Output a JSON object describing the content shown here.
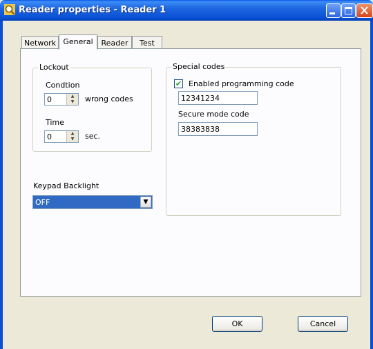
{
  "window": {
    "title": "Reader properties - Reader 1"
  },
  "tabs": [
    {
      "label": "Network"
    },
    {
      "label": "General",
      "active": true
    },
    {
      "label": "Reader"
    },
    {
      "label": "Test"
    }
  ],
  "lockout": {
    "legend": "Lockout",
    "condition_label": "Condtion",
    "condition_value": "0",
    "condition_unit": "wrong codes",
    "time_label": "Time",
    "time_value": "0",
    "time_unit": "sec."
  },
  "special_codes": {
    "legend": "Special codes",
    "enabled_checked": true,
    "enabled_label": "Enabled programming code",
    "programming_code": "12341234",
    "secure_label": "Secure mode code",
    "secure_code": "38383838"
  },
  "backlight": {
    "label": "Keypad Backlight",
    "selected": "OFF"
  },
  "buttons": {
    "ok": "OK",
    "cancel": "Cancel"
  },
  "icons": {
    "app": "magnifier-reader-icon",
    "check": "checkmark-icon",
    "spin_up": "arrow-up-icon",
    "spin_down": "arrow-down-icon",
    "dropdown": "chevron-down-icon"
  }
}
